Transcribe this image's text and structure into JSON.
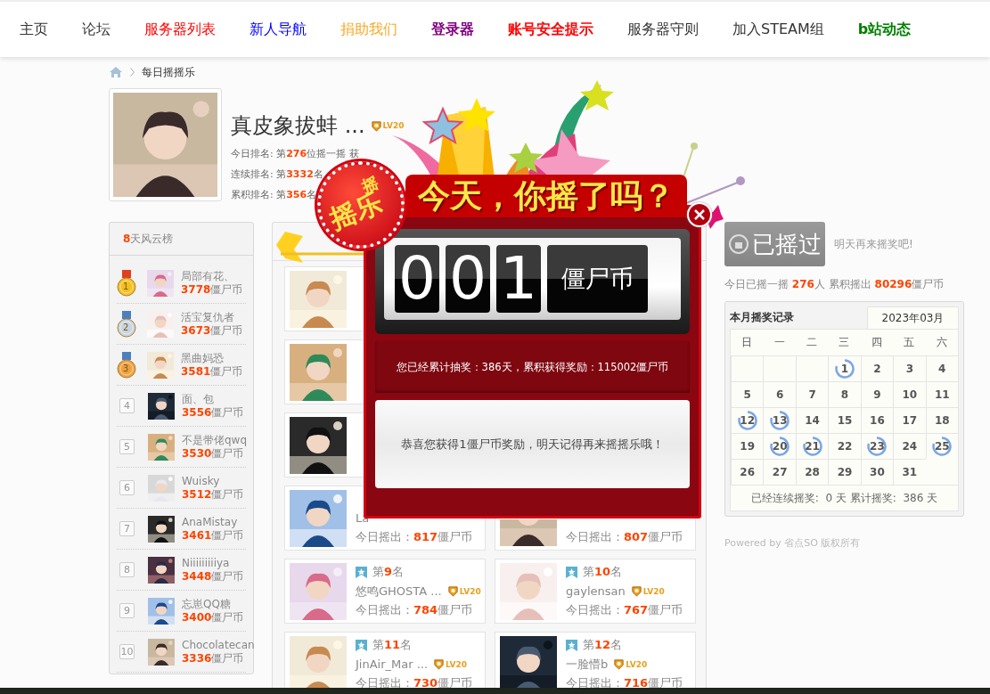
{
  "nav": [
    {
      "label": "主页",
      "color": "#333333",
      "bold": false
    },
    {
      "label": "论坛",
      "color": "#333333",
      "bold": false
    },
    {
      "label": "服务器列表",
      "color": "#ff0000",
      "bold": false
    },
    {
      "label": "新人导航",
      "color": "#0000ff",
      "bold": false
    },
    {
      "label": "捐助我们",
      "color": "#f9a825",
      "bold": false
    },
    {
      "label": "登录器",
      "color": "#800080",
      "bold": true
    },
    {
      "label": "账号安全提示",
      "color": "#ff0000",
      "bold": true
    },
    {
      "label": "服务器守则",
      "color": "#333333",
      "bold": false
    },
    {
      "label": "加入STEAM组",
      "color": "#333333",
      "bold": false
    },
    {
      "label": "b站动态",
      "color": "#008000",
      "bold": true
    }
  ],
  "breadcrumb": "每日摇摇乐",
  "profile": {
    "name": "真皮象拔蚌 ...",
    "badge": "LV20",
    "lines": [
      "今日排名: 第**276**位摇一摇 获",
      "连续排名: 第**3332**名",
      "累积排名: 第**356**名"
    ]
  },
  "leaderboard": {
    "title_count": "8",
    "title": "天风云榜",
    "rows": [
      {
        "kind": "gold",
        "rank": "1",
        "name": "局部有花、",
        "amount": "3778",
        "unit": "僵尸币"
      },
      {
        "kind": "silver",
        "rank": "2",
        "name": "活宝复仇者",
        "amount": "3673",
        "unit": "僵尸币"
      },
      {
        "kind": "bronze",
        "rank": "3",
        "name": "黑曲妈恐",
        "amount": "3581",
        "unit": "僵尸币"
      },
      {
        "kind": "plain",
        "rank": "4",
        "name": "面、包",
        "amount": "3556",
        "unit": "僵尸币"
      },
      {
        "kind": "plain",
        "rank": "5",
        "name": "不是带佬qwq",
        "amount": "3530",
        "unit": "僵尸币"
      },
      {
        "kind": "plain",
        "rank": "6",
        "name": "Wuisky",
        "amount": "3512",
        "unit": "僵尸币"
      },
      {
        "kind": "plain",
        "rank": "7",
        "name": "AnaMistay",
        "amount": "3461",
        "unit": "僵尸币"
      },
      {
        "kind": "plain",
        "rank": "8",
        "name": "Niiiiiiiiiya",
        "amount": "3448",
        "unit": "僵尸币"
      },
      {
        "kind": "plain",
        "rank": "9",
        "name": "忘崽QQ糖",
        "amount": "3400",
        "unit": "僵尸币"
      },
      {
        "kind": "plain",
        "rank": "10",
        "name": "Chocolatecan",
        "amount": "3336",
        "unit": "僵尸币"
      }
    ]
  },
  "cards": [
    {
      "kind": "covered"
    },
    {
      "kind": "hidden"
    },
    {
      "kind": "covered"
    },
    {
      "kind": "hidden"
    },
    {
      "kind": "covered"
    },
    {
      "kind": "hidden"
    },
    {
      "kind": "shown",
      "name": "La",
      "label": "今日摇出：",
      "amount": "817",
      "unit": "僵尸币"
    },
    {
      "kind": "lower",
      "label": "今日摇出：",
      "amount": "807",
      "unit": "僵尸币"
    },
    {
      "kind": "shown",
      "rank_prefix": "第",
      "rank": "9",
      "rank_suffix": "名",
      "name": "悠鸣GHOSTA ...",
      "badge": "LV20",
      "label": "今日摇出：",
      "amount": "784",
      "unit": "僵尸币"
    },
    {
      "kind": "shown",
      "rank_prefix": "第",
      "rank": "10",
      "rank_suffix": "名",
      "name": "gaylensan",
      "badge": "LV20",
      "label": "今日摇出：",
      "amount": "767",
      "unit": "僵尸币"
    },
    {
      "kind": "shown",
      "rank_prefix": "第",
      "rank": "11",
      "rank_suffix": "名",
      "name": "JinAir_Mar ...",
      "badge": "LV20",
      "label": "今日摇出：",
      "amount": "730",
      "unit": "僵尸币"
    },
    {
      "kind": "shown",
      "rank_prefix": "第",
      "rank": "12",
      "rank_suffix": "名",
      "name": "一脸懵b",
      "badge": "LV20",
      "label": "今日摇出：",
      "amount": "716",
      "unit": "僵尸币"
    }
  ],
  "shake": {
    "button": "已摇过",
    "hint": "明天再来摇奖吧!",
    "stats": "今日已摇一摇 **276**人 累积摇出 **80296**僵尸币"
  },
  "calendar": {
    "title": "本月摇奖记录",
    "month": "2023年03月",
    "weekdays": [
      "日",
      "一",
      "二",
      "三",
      "四",
      "五",
      "六"
    ],
    "days": [
      {
        "kind": "blank"
      },
      {
        "kind": "blank"
      },
      {
        "kind": "blank"
      },
      {
        "kind": "day",
        "day": "1",
        "shaken": true
      },
      {
        "kind": "day",
        "day": "2",
        "shaken": false
      },
      {
        "kind": "day",
        "day": "3",
        "shaken": false
      },
      {
        "kind": "day",
        "day": "4",
        "shaken": false
      },
      {
        "kind": "day",
        "day": "5",
        "shaken": false
      },
      {
        "kind": "day",
        "day": "6",
        "shaken": false
      },
      {
        "kind": "day",
        "day": "7",
        "shaken": false
      },
      {
        "kind": "day",
        "day": "8",
        "shaken": false
      },
      {
        "kind": "day",
        "day": "9",
        "shaken": false
      },
      {
        "kind": "day",
        "day": "10",
        "shaken": false
      },
      {
        "kind": "day",
        "day": "11",
        "shaken": false
      },
      {
        "kind": "day",
        "day": "12",
        "shaken": true
      },
      {
        "kind": "day",
        "day": "13",
        "shaken": true
      },
      {
        "kind": "day",
        "day": "14",
        "shaken": false
      },
      {
        "kind": "day",
        "day": "15",
        "shaken": false
      },
      {
        "kind": "day",
        "day": "16",
        "shaken": false
      },
      {
        "kind": "day",
        "day": "17",
        "shaken": false
      },
      {
        "kind": "day",
        "day": "18",
        "shaken": false
      },
      {
        "kind": "day",
        "day": "19",
        "shaken": false
      },
      {
        "kind": "day",
        "day": "20",
        "shaken": true
      },
      {
        "kind": "day",
        "day": "21",
        "shaken": true
      },
      {
        "kind": "day",
        "day": "22",
        "shaken": false
      },
      {
        "kind": "day",
        "day": "23",
        "shaken": true
      },
      {
        "kind": "day",
        "day": "24",
        "shaken": false
      },
      {
        "kind": "day",
        "day": "25",
        "shaken": true
      },
      {
        "kind": "day",
        "day": "26",
        "shaken": false
      },
      {
        "kind": "day",
        "day": "27",
        "shaken": false
      },
      {
        "kind": "day",
        "day": "28",
        "shaken": false
      },
      {
        "kind": "day",
        "day": "29",
        "shaken": false
      },
      {
        "kind": "day",
        "day": "30",
        "shaken": false
      },
      {
        "kind": "day",
        "day": "31",
        "shaken": false
      }
    ],
    "footer": "已经连续摇奖:  0 天 累计摇奖:  386 天"
  },
  "powered": "Powered by 省点SO 版权所有",
  "popup": {
    "badge_small": "摇",
    "badge_big": "摇乐",
    "title": "今天，你摇了吗？",
    "digits": [
      "0",
      "0",
      "1"
    ],
    "unit": "僵尸币",
    "summary": "您已经累计抽奖：386天，累积获得奖励：115002僵尸币",
    "message": "恭喜您获得1僵尸币奖励，明天记得再来摇摇乐哦！"
  }
}
